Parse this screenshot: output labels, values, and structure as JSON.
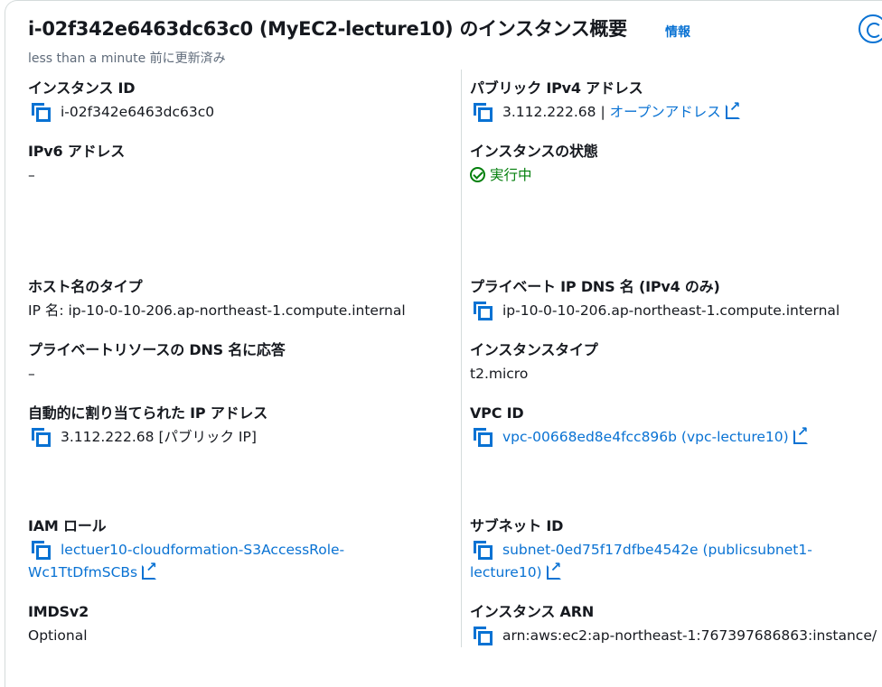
{
  "header": {
    "title": "i-02f342e6463dc63c0 (MyEC2-lecture10) のインスタンス概要",
    "info_label": "情報",
    "last_updated": "less than a minute 前に更新済み"
  },
  "left": {
    "instance_id": {
      "label": "インスタンス ID",
      "value": "i-02f342e6463dc63c0"
    },
    "ipv6": {
      "label": "IPv6 アドレス",
      "value": "–"
    },
    "hostname_type": {
      "label": "ホスト名のタイプ",
      "value": "IP 名: ip-10-0-10-206.ap-northeast-1.compute.internal"
    },
    "private_dns_answer": {
      "label": "プライベートリソースの DNS 名に応答",
      "value": "–"
    },
    "auto_ip": {
      "label": "自動的に割り当てられた IP アドレス",
      "value": "3.112.222.68 [パブリック IP]"
    },
    "iam_role": {
      "label": "IAM ロール",
      "value_line1": "lectuer10-cloudformation-S3AccessRole-",
      "value_line2": "Wc1TtDfmSCBs"
    },
    "imdsv2": {
      "label": "IMDSv2",
      "value": "Optional"
    }
  },
  "right": {
    "public_ipv4": {
      "label": "パブリック IPv4 アドレス",
      "value": "3.112.222.68",
      "separator": "|",
      "link": "オープンアドレス"
    },
    "state": {
      "label": "インスタンスの状態",
      "value": "実行中"
    },
    "private_dns": {
      "label": "プライベート IP DNS 名 (IPv4 のみ)",
      "value": "ip-10-0-10-206.ap-northeast-1.compute.internal"
    },
    "instance_type": {
      "label": "インスタンスタイプ",
      "value": "t2.micro"
    },
    "vpc_id": {
      "label": "VPC ID",
      "value": "vpc-00668ed8e4fcc896b (vpc-lecture10)"
    },
    "subnet_id": {
      "label": "サブネット ID",
      "value_line1": "subnet-0ed75f17dfbe4542e (publicsubnet1-",
      "value_line2": "lecture10)"
    },
    "instance_arn": {
      "label": "インスタンス ARN",
      "value": "arn:aws:ec2:ap-northeast-1:767397686863:instance/"
    }
  },
  "colors": {
    "link": "#0972d3",
    "success": "#037f0c",
    "text": "#16191f",
    "muted": "#5f6b7a"
  }
}
